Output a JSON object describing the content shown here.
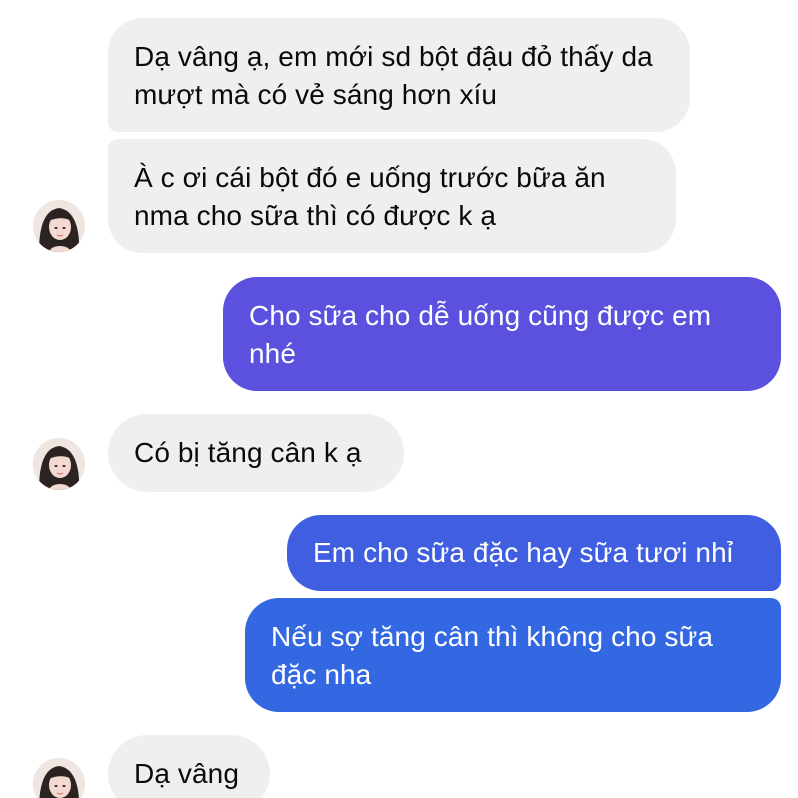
{
  "colors": {
    "incoming_bubble": "#efefef",
    "incoming_text": "#0a0a0a",
    "outgoing_gradient_violet": "#5b51de",
    "outgoing_gradient_blue": "#3168e2",
    "outgoing_text": "#ffffff"
  },
  "icons": {
    "avatar": "contact-avatar-photo"
  },
  "messages": [
    {
      "direction": "incoming",
      "text": "Dạ vâng ạ, em mới sd bột đậu đỏ thấy da mượt mà có vẻ sáng hơn xíu",
      "color": "#efefef"
    },
    {
      "direction": "incoming",
      "text": "À c ơi cái bột đó e uống trước bữa ăn nma cho sữa thì có được k ạ",
      "color": "#efefef"
    },
    {
      "direction": "outgoing",
      "text": "Cho sữa cho dễ uống cũng được em nhé",
      "color": "#5b51de"
    },
    {
      "direction": "incoming",
      "text": "Có bị tăng cân k ạ",
      "color": "#efefef"
    },
    {
      "direction": "outgoing",
      "text": "Em cho sữa đặc hay sữa tươi nhỉ",
      "color": "#3f5fe0"
    },
    {
      "direction": "outgoing",
      "text": "Nếu sợ tăng cân thì không cho sữa đặc nha",
      "color": "#3368e2"
    },
    {
      "direction": "incoming",
      "text": "Dạ vâng",
      "color": "#efefef"
    }
  ]
}
